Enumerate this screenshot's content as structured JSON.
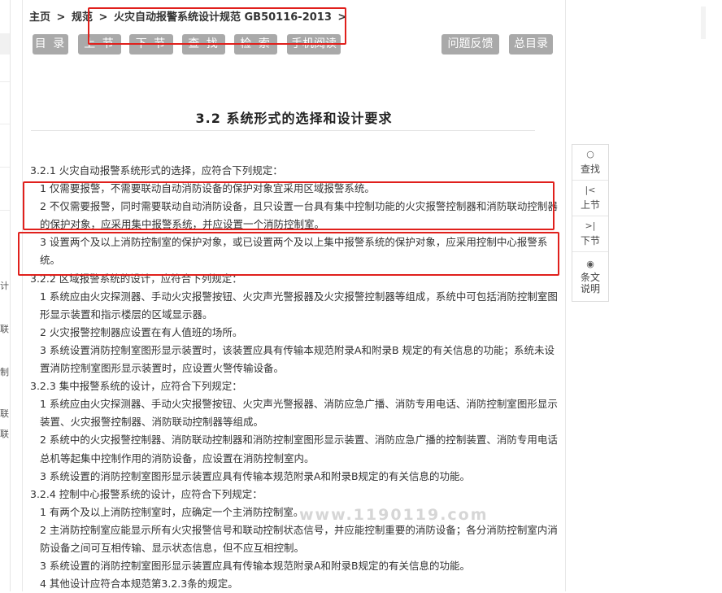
{
  "breadcrumb": {
    "home": "主页",
    "level1": "规范",
    "current": "火灾自动报警系统设计规范 GB50116-2013",
    "separator": ">",
    "trailing": ">"
  },
  "toolbar": {
    "buttons": [
      "目 录",
      "上 节",
      "下 节",
      "查 找",
      "检 索",
      "手机阅读"
    ],
    "feedback": "问题反馈",
    "catalog": "总目录"
  },
  "page": {
    "title": "3.2 系统形式的选择和设计要求"
  },
  "content": [
    "3.2.1 火灾自动报警系统形式的选择，应符合下列规定：",
    "1 仅需要报警，不需要联动自动消防设备的保护对象宜采用区域报警系统。",
    "2 不仅需要报警，同时需要联动自动消防设备，且只设置一台具有集中控制功能的火灾报警控制器和消防联动控制器的保护对象，应采用集中报警系统，并应设置一个消防控制室。",
    "3 设置两个及以上消防控制室的保护对象，或已设置两个及以上集中报警系统的保护对象，应采用控制中心报警系统。",
    "3.2.2 区域报警系统的设计，应符合下列规定：",
    "1 系统应由火灾探测器、手动火灾报警按钮、火灾声光警报器及火灾报警控制器等组成，系统中可包括消防控制室图形显示装置和指示楼层的区域显示器。",
    "2 火灾报警控制器应设置在有人值班的场所。",
    "3 系统设置消防控制室图形显示装置时，该装置应具有传输本规范附录A和附录B 规定的有关信息的功能；系统未设置消防控制室图形显示装置时，应设置火警传输设备。",
    "3.2.3 集中报警系统的设计，应符合下列规定：",
    "1 系统应由火灾探测器、手动火灾报警按钮、火灾声光警报器、消防应急广播、消防专用电话、消防控制室图形显示装置、火灾报警控制器、消防联动控制器等组成。",
    "2 系统中的火灾报警控制器、消防联动控制器和消防控制室图形显示装置、消防应急广播的控制装置、消防专用电话总机等起集中控制作用的消防设备，应设置在消防控制室内。",
    "3 系统设置的消防控制室图形显示装置应具有传输本规范附录A和附录B规定的有关信息的功能。",
    "3.2.4 控制中心报警系统的设计，应符合下列规定：",
    "1 有两个及以上消防控制室时，应确定一个主消防控制室。",
    "2 主消防控制室应能显示所有火灾报警信号和联动控制状态信号，并应能控制重要的消防设备；各分消防控制室内消防设备之间可互相传输、显示状态信息，但不应互相控制。",
    "3 系统设置的消防控制室图形显示装置应具有传输本规范附录A和附录B规定的有关信息的功能。",
    "4 其他设计应符合本规范第3.2.3条的规定。"
  ],
  "sidenav": [
    {
      "icon": "search-icon",
      "glyph": "○",
      "label": "查找"
    },
    {
      "icon": "prev-section-icon",
      "glyph": "|<",
      "label": "上节"
    },
    {
      "icon": "next-section-icon",
      "glyph": ">|",
      "label": "下节"
    },
    {
      "icon": "eye-icon",
      "glyph": "◉",
      "label": "条文说明"
    }
  ],
  "left_strip_fragments": [
    "计",
    "联",
    "制",
    "联",
    "联"
  ],
  "watermark": "www.1190119.com",
  "colors": {
    "button_bg": "#a9a9a9",
    "highlight_box": "#e0201c",
    "text": "#333333"
  }
}
